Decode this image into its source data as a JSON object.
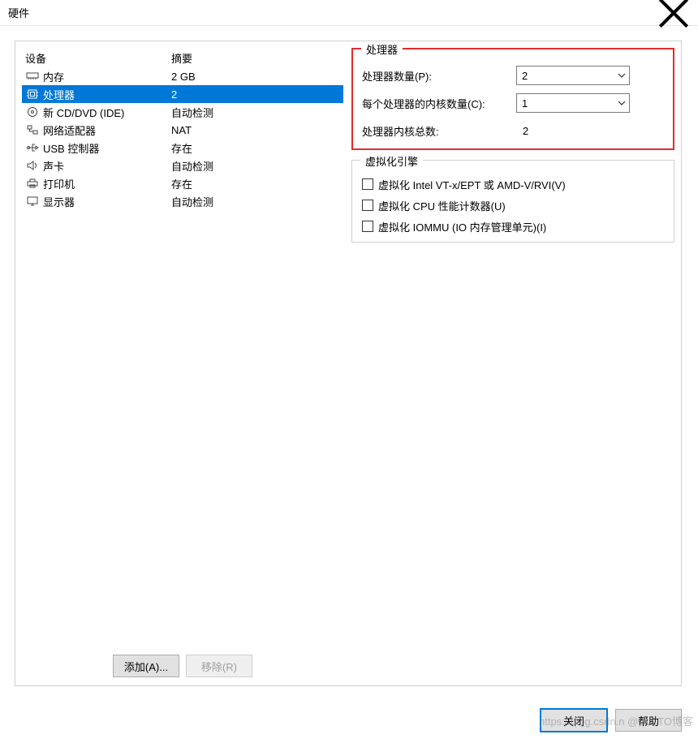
{
  "window": {
    "title": "硬件"
  },
  "columns": {
    "device": "设备",
    "summary": "摘要"
  },
  "devices": [
    {
      "icon": "memory-icon",
      "name": "内存",
      "summary": "2 GB",
      "selected": false
    },
    {
      "icon": "cpu-icon",
      "name": "处理器",
      "summary": "2",
      "selected": true
    },
    {
      "icon": "disc-icon",
      "name": "新 CD/DVD (IDE)",
      "summary": "自动检测",
      "selected": false
    },
    {
      "icon": "network-icon",
      "name": "网络适配器",
      "summary": "NAT",
      "selected": false
    },
    {
      "icon": "usb-icon",
      "name": "USB 控制器",
      "summary": "存在",
      "selected": false
    },
    {
      "icon": "sound-icon",
      "name": "声卡",
      "summary": "自动检测",
      "selected": false
    },
    {
      "icon": "printer-icon",
      "name": "打印机",
      "summary": "存在",
      "selected": false
    },
    {
      "icon": "display-icon",
      "name": "显示器",
      "summary": "自动检测",
      "selected": false
    }
  ],
  "left_buttons": {
    "add": "添加(A)...",
    "remove": "移除(R)"
  },
  "processor_group": {
    "title": "处理器",
    "num_processors_label": "处理器数量(P):",
    "num_processors_value": "2",
    "cores_per_label": "每个处理器的内核数量(C):",
    "cores_per_value": "1",
    "total_cores_label": "处理器内核总数:",
    "total_cores_value": "2"
  },
  "virt_group": {
    "title": "虚拟化引擎",
    "opt_vt": "虚拟化 Intel VT-x/EPT 或 AMD-V/RVI(V)",
    "opt_perf": "虚拟化 CPU 性能计数器(U)",
    "opt_iommu": "虚拟化 IOMMU (IO 内存管理单元)(I)"
  },
  "footer": {
    "close": "关闭",
    "help": "帮助"
  },
  "watermark": "https://blog.csdn.n @51CTO博客"
}
